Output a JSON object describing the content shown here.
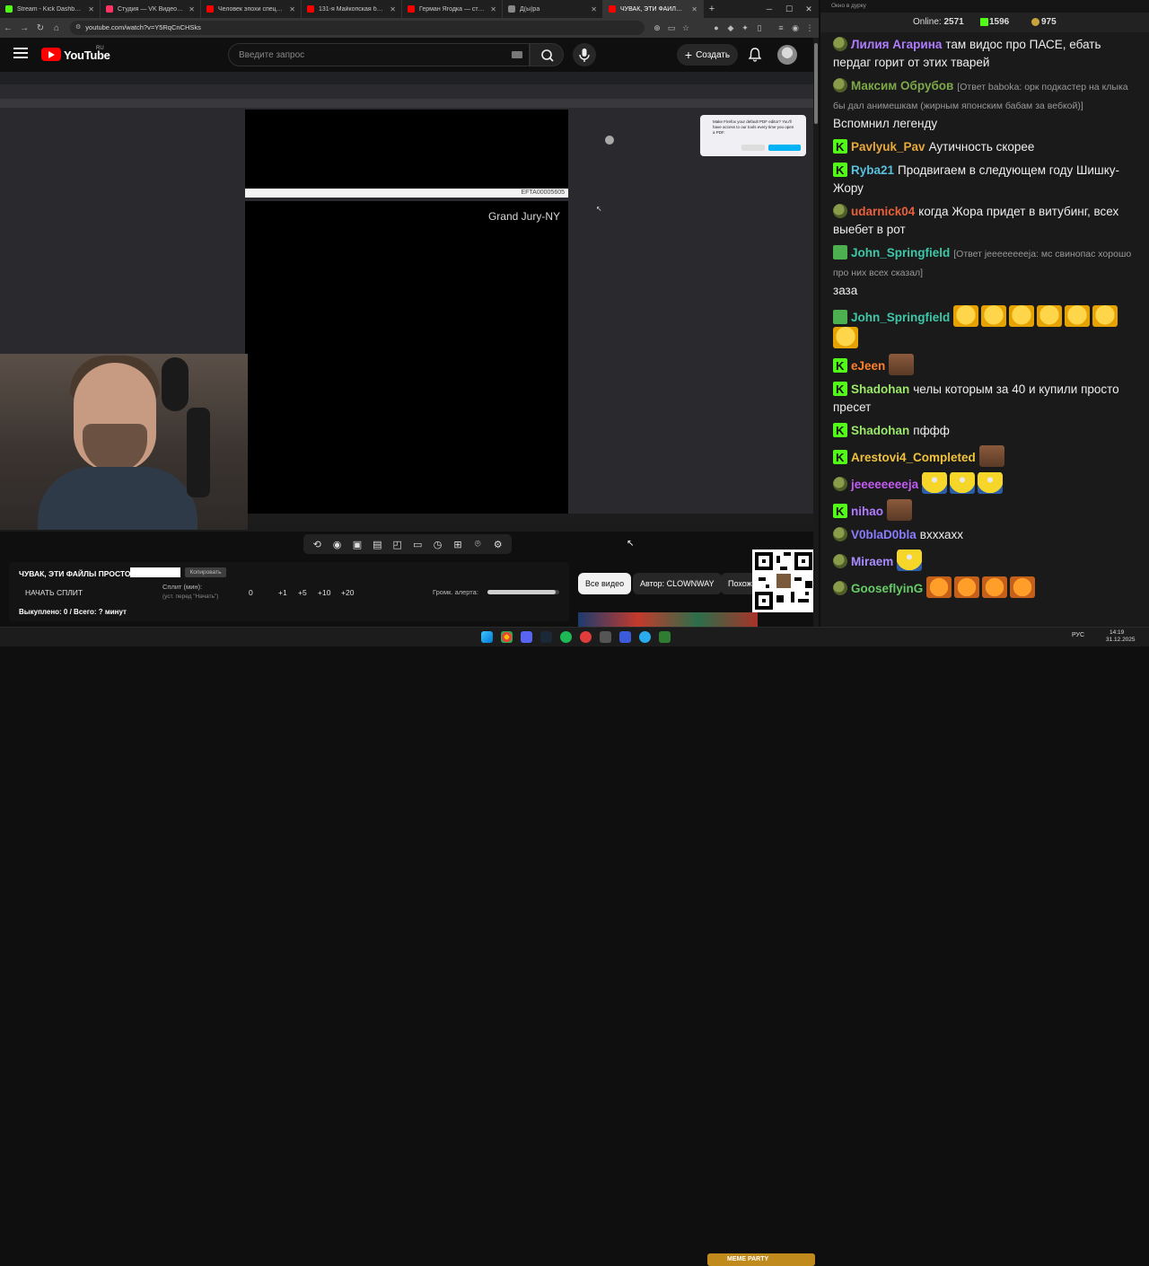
{
  "browser": {
    "tabs": [
      {
        "label": "Stream - Kick Dashboard",
        "color": "#53fc18"
      },
      {
        "label": "Студия — VK Видео Live",
        "color": "#ff3366"
      },
      {
        "label": "Человек эпохи спецназа. Х",
        "color": "#ff0000"
      },
      {
        "label": "131-я Майкопская бригада",
        "color": "#ff0000"
      },
      {
        "label": "Герман Ягодка — становле",
        "color": "#ff0000"
      },
      {
        "label": "Д(ы)ра",
        "color": "#888888"
      },
      {
        "label": "ЧУВАК, ЭТИ ФАЙЛЫ ПРО",
        "color": "#ff0000",
        "active": true
      }
    ],
    "new_tab": "+",
    "url": "youtube.com/watch?v=Y5RqCnCHSks"
  },
  "youtube": {
    "wordmark": "YouTube",
    "region": "RU",
    "search_placeholder": "Введите запрос",
    "create_label": "Создать"
  },
  "video": {
    "pdf_stripe_code": "EFTA00005605",
    "pdf_label": "Grand Jury-NY",
    "popup_text": "Make Firefox your default PDF editor? You'll have access to our tools every time you open a PDF."
  },
  "split_panel": {
    "title": "ЧУВАК, ЭТИ ФАЙЛЫ ПРОСТО",
    "copy_label": "Копировать",
    "start_label": "НАЧАТЬ СПЛИТ",
    "minutes_label": "Сплит (мин):",
    "minutes_hint": "(уст. перед \"Начать\")",
    "value": "0",
    "inc1": "+1",
    "inc5": "+5",
    "inc10": "+10",
    "inc20": "+20",
    "alert_label": "Громк. алерта:",
    "alert_volume": 0.95,
    "bought": "Выкуплено: 0 / Всего: ? минут"
  },
  "chips": {
    "all": "Все видео",
    "author": "Автор: CLOWNWAY",
    "similar": "Похож"
  },
  "chat": {
    "window_title": "Окно в дурку",
    "online_label": "Online:",
    "online_count": "2571",
    "kick_count": "1596",
    "coin_count": "975",
    "messages": [
      {
        "badge": "pepe",
        "user": "Лилия Агарина",
        "color": "#b07cff",
        "text": "там видос про ПАСЕ, ебать пердаг горит от этих тварей"
      },
      {
        "badge": "pepe",
        "user": "Максим Обрубов",
        "color": "#7ea848",
        "reply": "[Ответ baboka: орк подкастер на клыка бы дал анимешкам (жирным  японским бабам за вебкой)]",
        "text": "Вспомнил легенду"
      },
      {
        "badge": "k",
        "user": "Pavlyuk_Pav",
        "color": "#e8a93c",
        "text": "Аутичность скорее"
      },
      {
        "badge": "k",
        "user": "Ryba21",
        "color": "#5bc0de",
        "text": "Продвигаем в следующем году Шишку-Жору"
      },
      {
        "badge": "pepe",
        "user": "udarnick04",
        "color": "#e8603c",
        "text": "когда Жора придет в витубинг, всех выебет в рот"
      },
      {
        "badge": "pen",
        "user": "John_Springfield",
        "color": "#3cc8a8",
        "reply": "[Ответ jeeeeeeeeja: мс свинопас хорошо про них всех сказал]",
        "text": "заза"
      },
      {
        "badge": "pen",
        "user": "John_Springfield",
        "color": "#3cc8a8",
        "emotes": [
          "laugh",
          "laugh",
          "laugh",
          "laugh",
          "laugh",
          "laugh",
          "laugh"
        ]
      },
      {
        "badge": "k",
        "user": "eJeen",
        "color": "#ff7f2a",
        "emotes": [
          "man"
        ]
      },
      {
        "badge": "k",
        "user": "Shadohan",
        "color": "#9be86a",
        "text": "челы которым за 40 и купили просто пресет"
      },
      {
        "badge": "k",
        "user": "Shadohan",
        "color": "#9be86a",
        "text": "пффф"
      },
      {
        "badge": "k",
        "user": "Arestovi4_Completed",
        "color": "#f0c23c",
        "emotes": [
          "man"
        ]
      },
      {
        "badge": "pepe",
        "user": "jeeeeeeeeja",
        "color": "#c05cf0",
        "emotes": [
          "minion",
          "minion",
          "minion"
        ]
      },
      {
        "badge": "k",
        "user": "nihao",
        "color": "#b07cff",
        "emotes": [
          "man"
        ]
      },
      {
        "badge": "pepe",
        "user": "V0blaD0bla",
        "color": "#8a7cff",
        "text": "вхххахх"
      },
      {
        "badge": "pepe",
        "user": "Miraem",
        "color": "#a88cff",
        "emotes": [
          "minion"
        ]
      },
      {
        "badge": "pepe",
        "user": "GooseflyinG",
        "color": "#66cc66",
        "emotes": [
          "tiger",
          "tiger",
          "tiger",
          "tiger"
        ]
      }
    ]
  },
  "taskbar": {
    "meme_party": "MEME PARTY",
    "lang": "РУС",
    "time": "14:19",
    "date": "31.12.2025"
  }
}
